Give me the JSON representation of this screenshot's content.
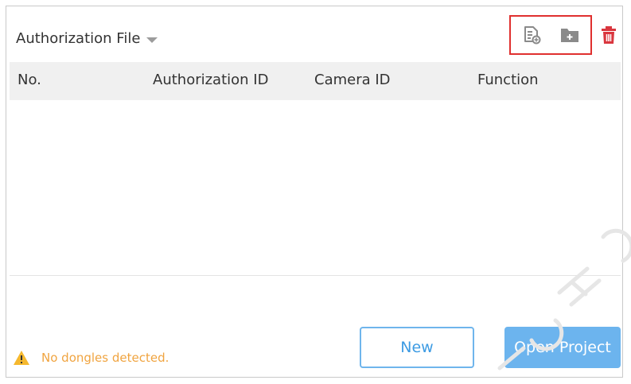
{
  "panel": {
    "title": "Authorization File"
  },
  "toolbar": {
    "icons": [
      "import-file-icon",
      "add-folder-icon",
      "trash-icon"
    ],
    "delete_color": "#d9363e",
    "highlight_color": "#e0302f"
  },
  "table": {
    "columns": [
      "No.",
      "Authorization ID",
      "Camera ID",
      "Function"
    ],
    "rows": []
  },
  "status": {
    "message": "No dongles detected.",
    "color": "#f0a440"
  },
  "buttons": {
    "new_label": "New",
    "open_project_label": "Open Project"
  }
}
